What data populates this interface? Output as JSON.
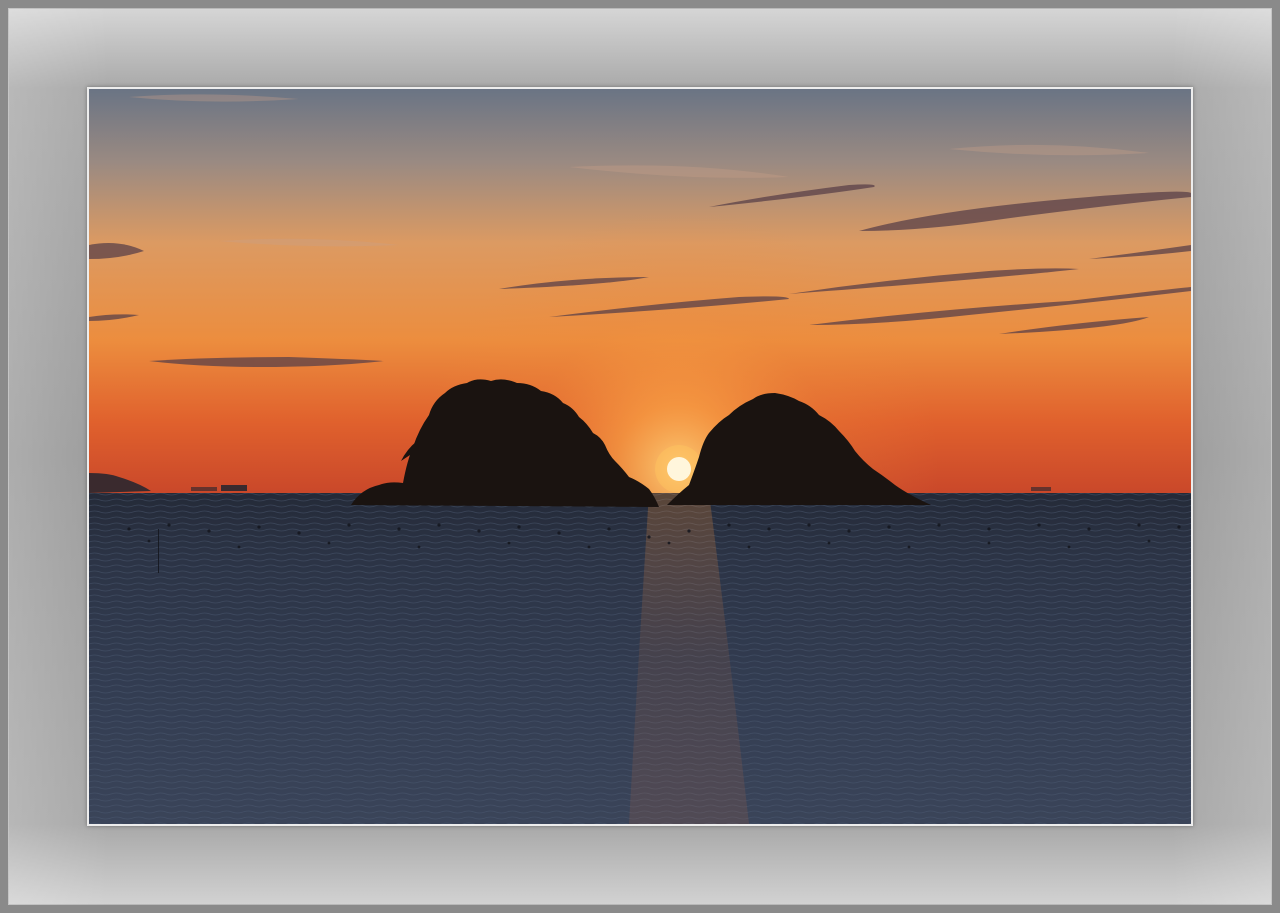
{
  "scene": {
    "subject": "sunset-over-sea-with-two-islands",
    "colors": {
      "sky_top": "#6f7784",
      "sky_mid": "#e79a52",
      "sky_horizon": "#d9582b",
      "sun": "#fff4d6",
      "sun_glow": "#ffb347",
      "island": "#1c1410",
      "sea_top": "#2b3445",
      "sea_bottom": "#3a465d",
      "frame_outer": "#8a8a8a",
      "frame_inner": "#ededed"
    }
  }
}
